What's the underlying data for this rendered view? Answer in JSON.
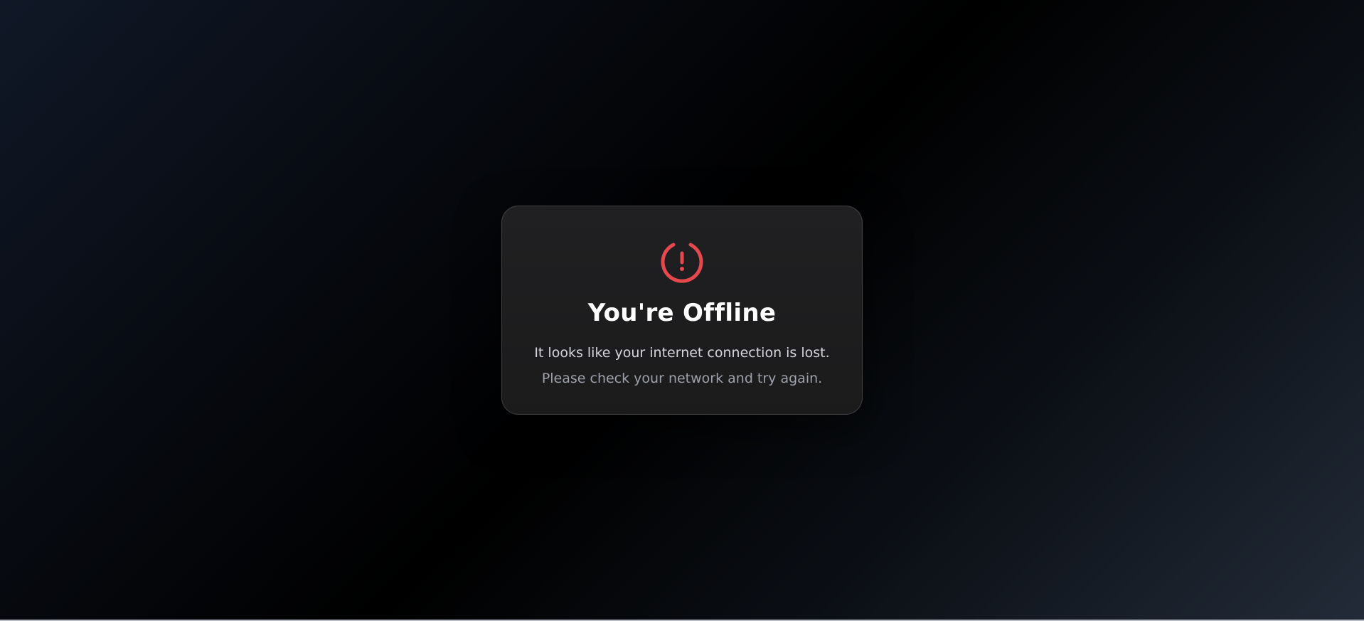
{
  "offline_card": {
    "icon": "power-alert-icon",
    "title": "You're Offline",
    "message_primary": "It looks like your internet connection is lost.",
    "message_secondary": "Please check your network and try again."
  },
  "colors": {
    "accent": "#e5484d",
    "title_text": "#ffffff",
    "primary_text": "#d4d6dc",
    "secondary_text": "#9ea2aa",
    "card_background": "#1e1e20"
  }
}
